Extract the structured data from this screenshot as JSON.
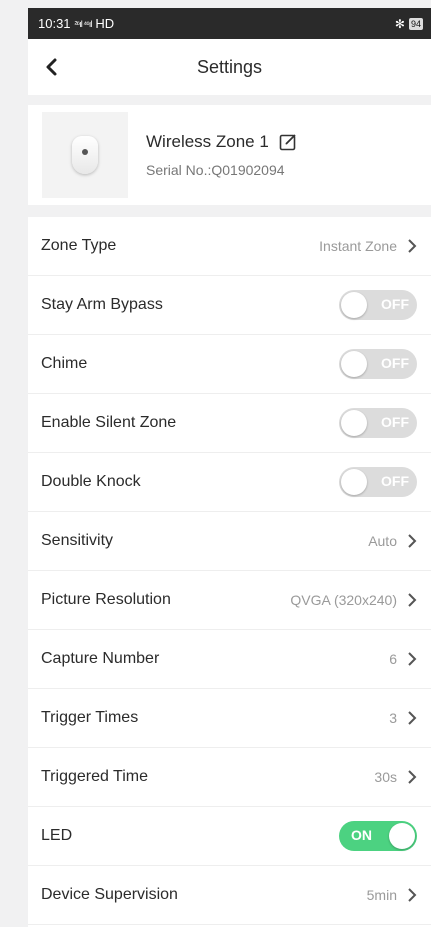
{
  "statusbar": {
    "time": "10:31",
    "signal": "²⁶ıl ⁴⁶ıl",
    "network": "HD",
    "battery": "94"
  },
  "header": {
    "title": "Settings"
  },
  "device": {
    "name": "Wireless Zone 1",
    "serial": "Serial No.:Q01902094"
  },
  "settings": [
    {
      "label": "Zone Type",
      "value": "Instant Zone"
    },
    {
      "label": "Stay Arm Bypass",
      "toggle": "OFF"
    },
    {
      "label": "Chime",
      "toggle": "OFF"
    },
    {
      "label": "Enable Silent Zone",
      "toggle": "OFF"
    },
    {
      "label": "Double Knock",
      "toggle": "OFF"
    },
    {
      "label": "Sensitivity",
      "value": "Auto"
    },
    {
      "label": "Picture Resolution",
      "value": "QVGA (320x240)"
    },
    {
      "label": "Capture Number",
      "value": "6"
    },
    {
      "label": "Trigger Times",
      "value": "3"
    },
    {
      "label": "Triggered Time",
      "value": "30s"
    },
    {
      "label": "LED",
      "toggle": "ON"
    },
    {
      "label": "Device Supervision",
      "value": "5min"
    }
  ],
  "colors": {
    "toggle_on": "#4cd281",
    "toggle_off": "#dcdcdc"
  }
}
